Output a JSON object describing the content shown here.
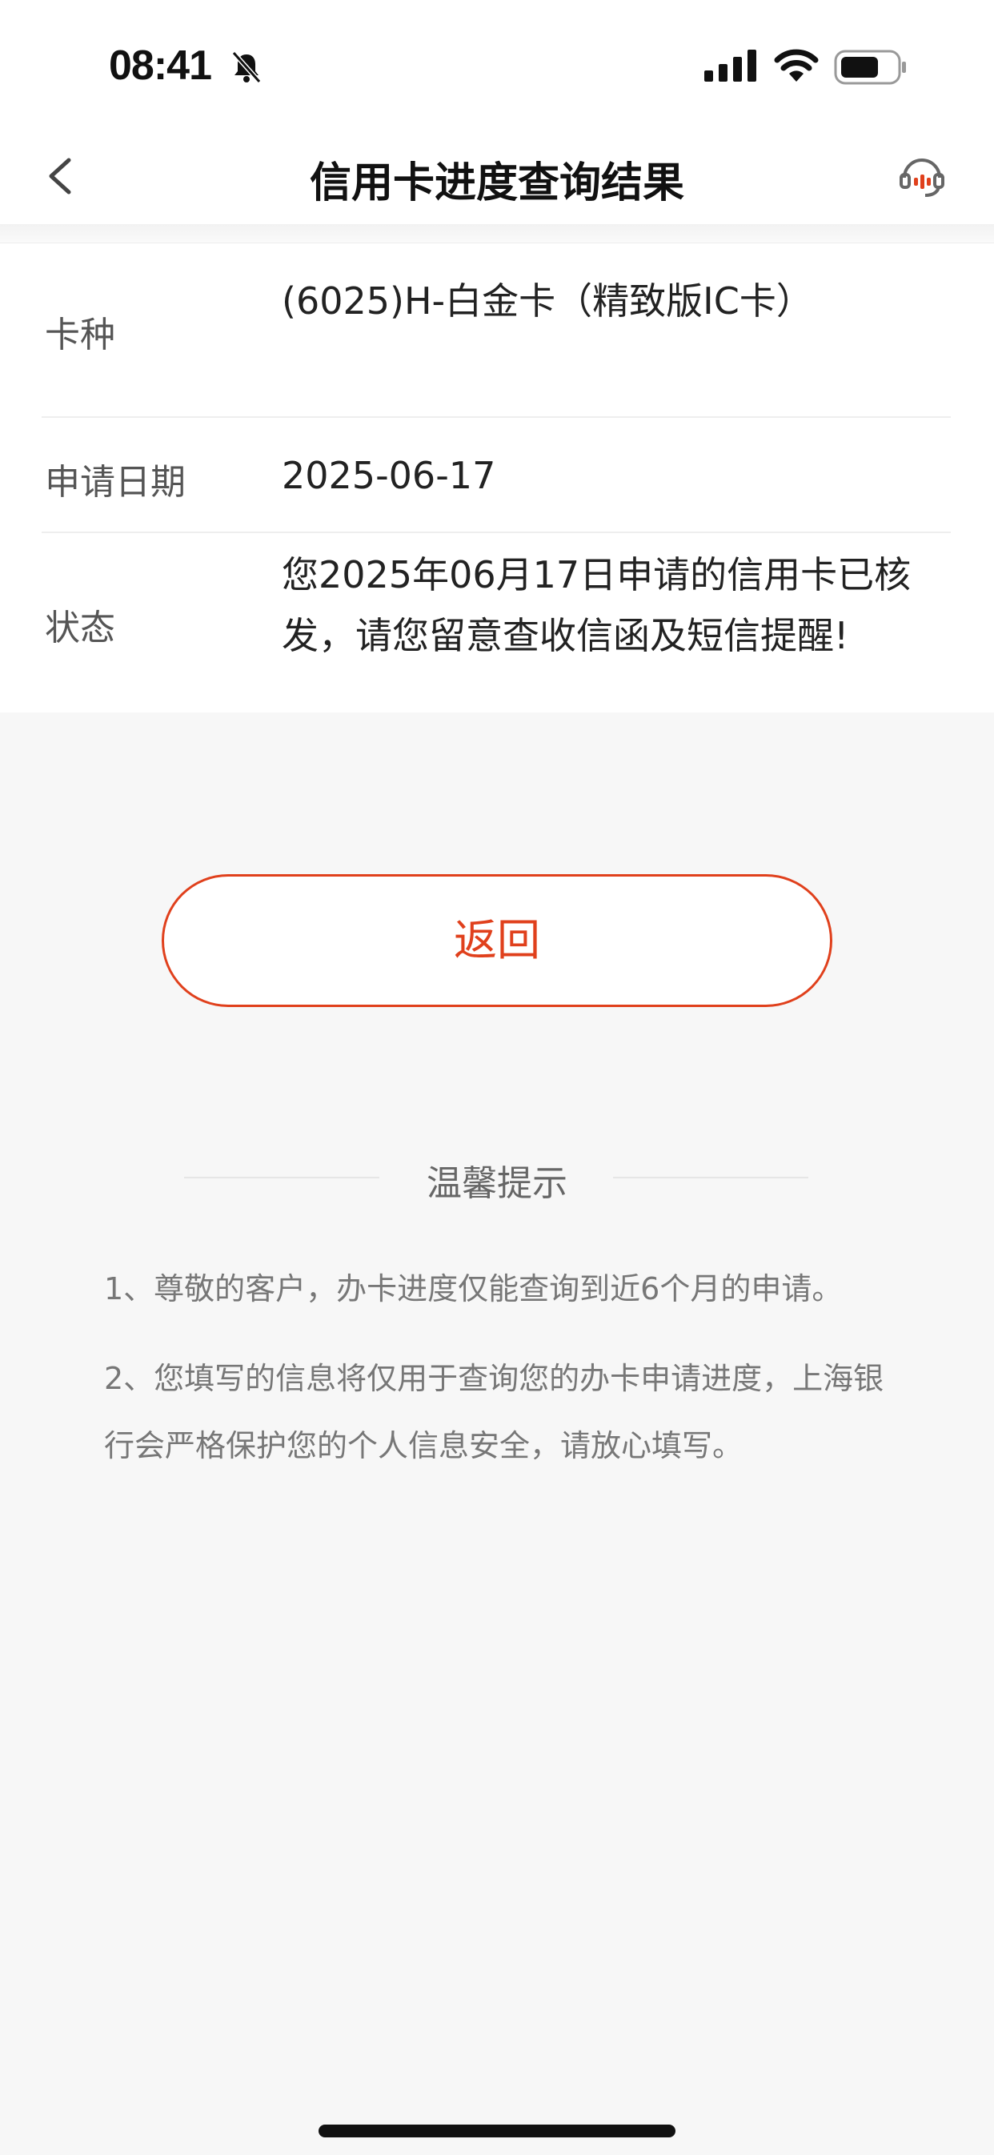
{
  "status_bar": {
    "time": "08:41"
  },
  "nav": {
    "title": "信用卡进度查询结果"
  },
  "details": {
    "card_type_label": "卡种",
    "card_type_value": "(6025)H-白金卡（精致版IC卡）",
    "apply_date_label": "申请日期",
    "apply_date_value": "2025-06-17",
    "status_label": "状态",
    "status_value": "您2025年06月17日申请的信用卡已核发，请您留意查收信函及短信提醒!"
  },
  "actions": {
    "back_label": "返回"
  },
  "tips": {
    "title": "温馨提示",
    "items": [
      "1、尊敬的客户，办卡进度仅能查询到近6个月的申请。",
      "2、您填写的信息将仅用于查询您的办卡申请进度，上海银行会严格保护您的个人信息安全，请放心填写。"
    ]
  },
  "colors": {
    "accent": "#e0401c",
    "background": "#f7f7f7"
  },
  "icons": {
    "back": "chevron-left-icon",
    "service": "customer-service-icon",
    "bell": "bell-slash-icon",
    "signal": "cellular-signal-icon",
    "wifi": "wifi-icon",
    "battery": "battery-icon"
  }
}
